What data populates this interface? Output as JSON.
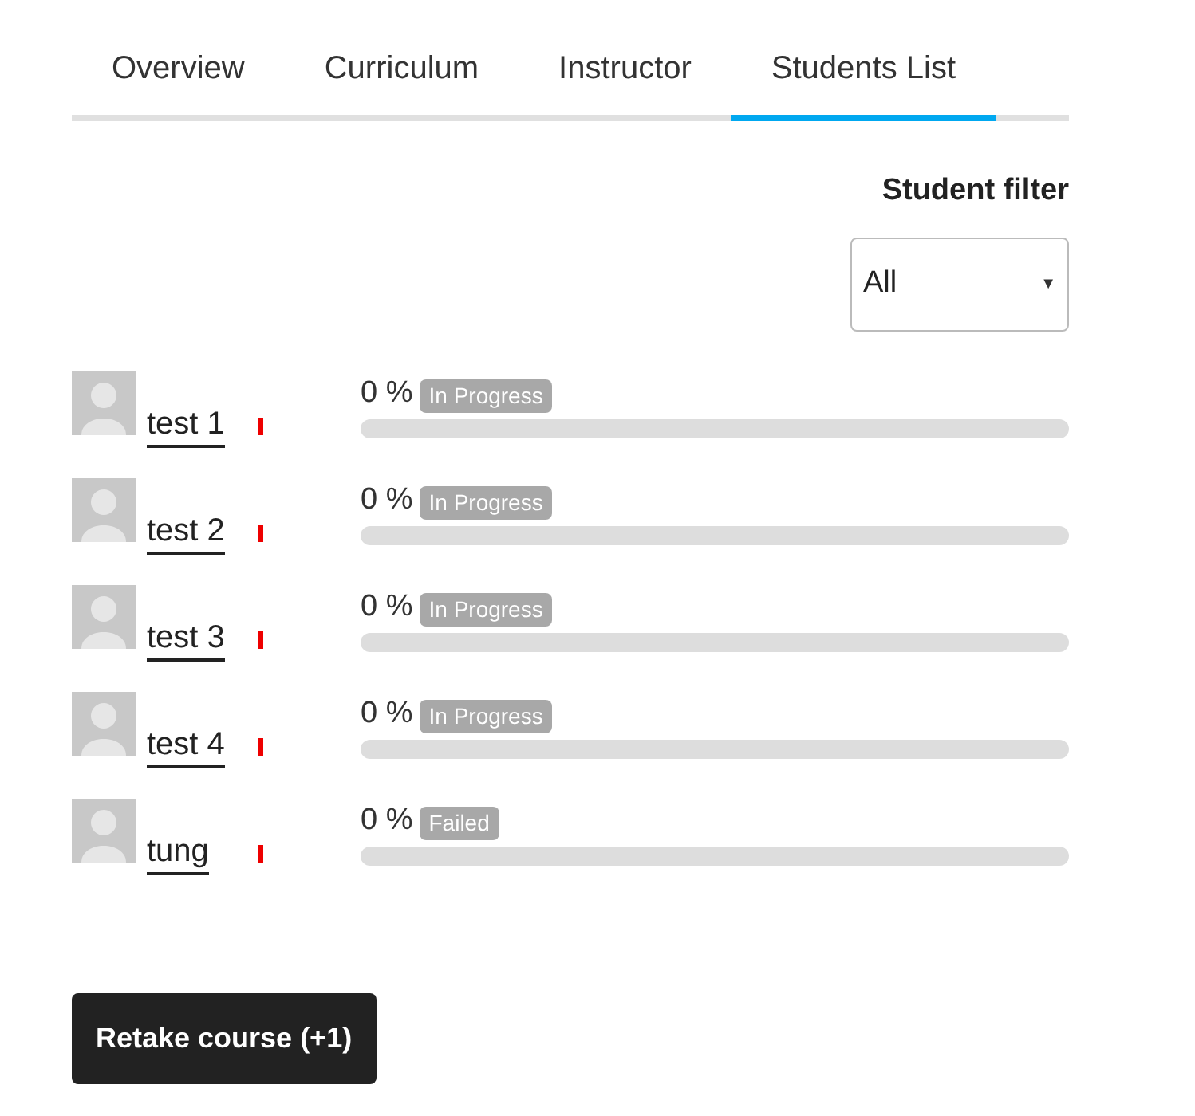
{
  "tabs": [
    {
      "label": "Overview",
      "selected": false
    },
    {
      "label": "Curriculum",
      "selected": false
    },
    {
      "label": "Instructor",
      "selected": false
    },
    {
      "label": "Students List",
      "selected": true
    }
  ],
  "student_filter": {
    "label": "Student filter",
    "value": "All",
    "caret": "▼"
  },
  "students": [
    {
      "name": "test 1",
      "progress": "0 %",
      "status": "In Progress",
      "level": 0
    },
    {
      "name": "test 2",
      "progress": "0 %",
      "status": "In Progress",
      "level": 0
    },
    {
      "name": "test 3",
      "progress": "0 %",
      "status": "In Progress",
      "level": 0
    },
    {
      "name": "test 4",
      "progress": "0 %",
      "status": "In Progress",
      "level": 0
    },
    {
      "name": "tung",
      "progress": "0 %",
      "status": "Failed",
      "level": 0
    }
  ],
  "retake_button": "Retake course (+1)"
}
